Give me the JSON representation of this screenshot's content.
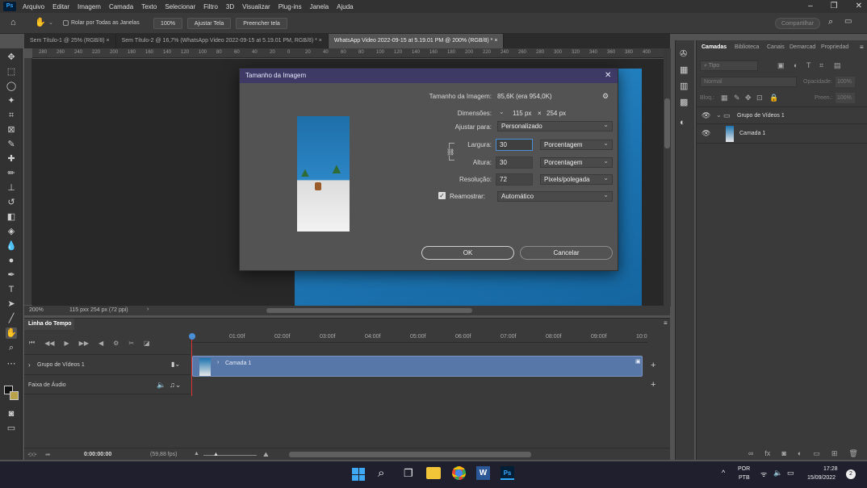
{
  "app": {
    "logo": "Ps"
  },
  "menu": [
    "Arquivo",
    "Editar",
    "Imagem",
    "Camada",
    "Texto",
    "Selecionar",
    "Filtro",
    "3D",
    "Visualizar",
    "Plug-ins",
    "Janela",
    "Ajuda"
  ],
  "options_bar": {
    "scroll_all": "Rolar por Todas as Janelas",
    "zoom": "100%",
    "fit": "Ajustar Tela",
    "fill": "Preencher tela",
    "share": "Compartilhar"
  },
  "tabs": [
    {
      "label": "Sem Título-1 @ 25% (RGB/8) ×"
    },
    {
      "label": "Sem Título-2 @ 16,7% (WhatsApp Video 2022-09-15 at 5.19.01 PM, RGB/8) * ×"
    },
    {
      "label": "WhatsApp Video 2022-09-15 at 5.19.01 PM @ 200% (RGB/8) * ×"
    }
  ],
  "ruler_ticks": [
    "280",
    "260",
    "240",
    "220",
    "200",
    "180",
    "160",
    "140",
    "120",
    "100",
    "80",
    "60",
    "40",
    "20",
    "0",
    "20",
    "40",
    "60",
    "80",
    "100",
    "120",
    "140",
    "160",
    "180",
    "200",
    "220",
    "240",
    "260",
    "280",
    "300",
    "320",
    "340",
    "360",
    "380",
    "400"
  ],
  "status": {
    "zoom": "200%",
    "info": "115 pxx 254 px (72 ppi)"
  },
  "dialog": {
    "title": "Tamanho da Imagem",
    "size_label": "Tamanho da Imagem:",
    "size_value": "85,6K (era 954,0K)",
    "dimensions_label": "Dimensões:",
    "dimensions_w": "115 px",
    "dimensions_x": "×",
    "dimensions_h": "254 px",
    "fit_label": "Ajustar para:",
    "fit_value": "Personalizado",
    "width_label": "Largura:",
    "width_value": "30",
    "width_unit": "Porcentagem",
    "height_label": "Altura:",
    "height_value": "30",
    "height_unit": "Porcentagem",
    "resolution_label": "Resolução:",
    "resolution_value": "72",
    "resolution_unit": "Pixels/polegada",
    "resample_label": "Reamostrar:",
    "resample_value": "Automático",
    "resample_checked": true,
    "ok": "OK",
    "cancel": "Cancelar"
  },
  "layers_panel": {
    "tabs": [
      "Camadas",
      "Biblioteca",
      "Canais",
      "Demarcad",
      "Propriedad"
    ],
    "search_placeholder": "Tipo",
    "blend_mode": "Normal",
    "opacity_label": "Opacidade:",
    "opacity_value": "100%",
    "lock_label": "Bloq.:",
    "fill_label": "Preen.:",
    "fill_value": "100%",
    "items": [
      {
        "name": "Grupo de Vídeos 1"
      },
      {
        "name": "Camada 1"
      }
    ]
  },
  "timeline": {
    "title": "Linha do Tempo",
    "time_marks": [
      "01:00f",
      "02:00f",
      "03:00f",
      "04:00f",
      "05:00f",
      "06:00f",
      "07:00f",
      "08:00f",
      "09:00f",
      "10:0"
    ],
    "group_track": "Grupo de Vídeos 1",
    "clip_label": "Camada 1",
    "audio_track": "Faixa de Áudio",
    "current_time": "0:00:00:00",
    "fps": "(59,88 fps)"
  },
  "taskbar": {
    "lang1": "POR",
    "lang2": "PTB",
    "time": "17:28",
    "date": "15/09/2022",
    "notifications": "2"
  },
  "colors": {
    "accent": "#3d3a66",
    "focus": "#4a8ed6",
    "canvas_blue": "#1c73b0",
    "clip": "#5777a8"
  }
}
